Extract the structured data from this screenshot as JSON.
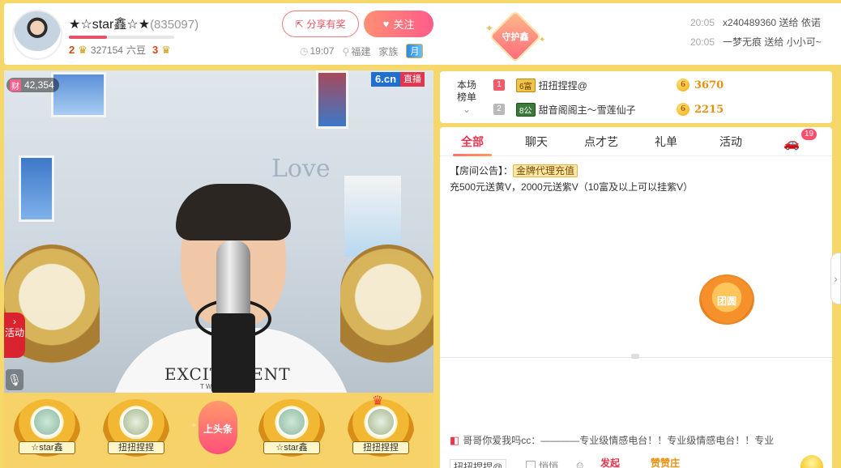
{
  "header": {
    "anchor_name": "★☆star鑫☆★",
    "room_id": "(835097)",
    "level_left": "2",
    "level_right": "3",
    "beans_value": "327154",
    "beans_unit": "六豆",
    "level_progress": 0.36,
    "share_label": "分享有奖",
    "follow_label": "关注",
    "time": "19:07",
    "location": "福建",
    "family_label": "家族",
    "month_badge": "月",
    "guard_label": "守护鑫"
  },
  "gift_log": [
    {
      "time": "20:05",
      "user": "x240489360",
      "action": "送给",
      "receiver": "依诺"
    },
    {
      "time": "20:05",
      "user": "一梦",
      "action": "无痕 送给",
      "receiver": "小小可~"
    }
  ],
  "video": {
    "fortune_tag": "财",
    "fortune_value": "42,354",
    "brand": "6.cn",
    "live_label": "直播",
    "activity_label": "活动",
    "shirt_text": "EXCITEMENT",
    "shirt_sub": "TWINA",
    "wall_text": "Love"
  },
  "seats": [
    {
      "name": "☆star鑫"
    },
    {
      "name": "扭扭捏捏"
    },
    {
      "name": "☆star鑫"
    },
    {
      "name": "扭扭捏捏"
    }
  ],
  "headline_label": "上头条",
  "rank": {
    "title_line1": "本场",
    "title_line2": "榜单",
    "rows": [
      {
        "no": "1",
        "badge": "6富",
        "name": "扭扭捏捏@",
        "value": "3670"
      },
      {
        "no": "2",
        "badge": "8公",
        "name": "甜音阁阁主～雪莲仙子",
        "value": "2215"
      }
    ]
  },
  "tabs": [
    {
      "label": "全部"
    },
    {
      "label": "聊天"
    },
    {
      "label": "点才艺"
    },
    {
      "label": "礼单"
    },
    {
      "label": "活动"
    }
  ],
  "car_badge": "19",
  "notice": {
    "prefix": "【房间公告】：",
    "tag": "金牌代理充值",
    "text": "充500元送黄V，2000元送紫V（10富及以上可以挂紫V）"
  },
  "mooncake_label": "团圆",
  "marquee": "哥哥你爱我吗cc：————专业级情感电台！！专业级情感电台！！专业",
  "input_row": {
    "to_label": "扭扭捏捏@",
    "chk_label": "悄悄",
    "fa_label": "发起",
    "fa2_label": "赞赞庄"
  },
  "colors": {
    "page_bg": "#f5d76a",
    "accent": "#e8364f",
    "brand_blue": "#1f6fd1"
  }
}
